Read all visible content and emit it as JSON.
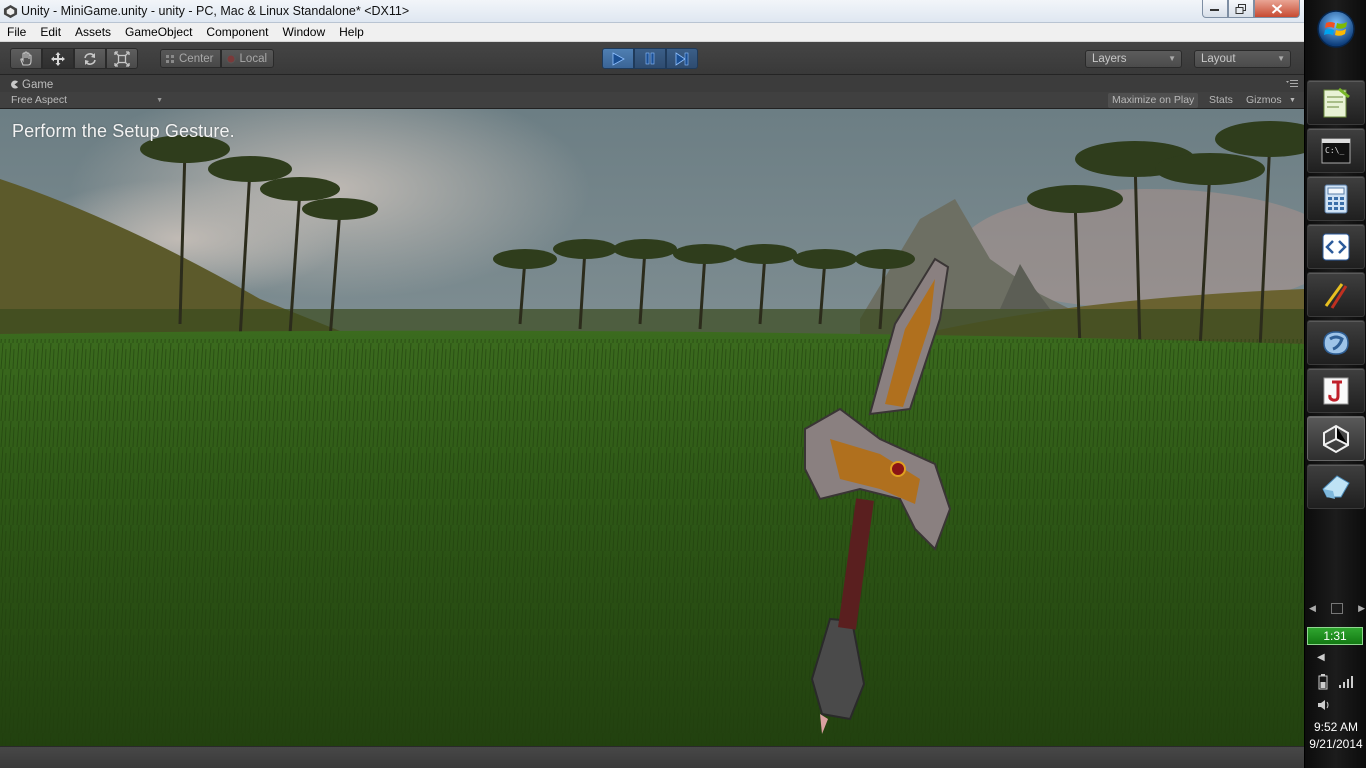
{
  "window": {
    "title": "Unity - MiniGame.unity - unity - PC, Mac & Linux Standalone* <DX11>"
  },
  "menu": {
    "items": [
      "File",
      "Edit",
      "Assets",
      "GameObject",
      "Component",
      "Window",
      "Help"
    ]
  },
  "toolbar": {
    "transform_tools": [
      "hand-icon",
      "move-icon",
      "rotate-icon",
      "scale-icon"
    ],
    "active_tool": "move-icon",
    "pivot_label": "Center",
    "space_label": "Local",
    "playback": [
      "play-icon",
      "pause-icon",
      "step-icon"
    ],
    "layers_label": "Layers",
    "layout_label": "Layout"
  },
  "game_panel": {
    "tab_label": "Game",
    "aspect_label": "Free Aspect",
    "maximize_label": "Maximize on Play",
    "stats_label": "Stats",
    "gizmos_label": "Gizmos"
  },
  "game_view": {
    "instruction_text": "Perform the Setup Gesture."
  },
  "taskbar": {
    "apps": [
      "notepad-plus-icon",
      "command-prompt-icon",
      "calculator-icon",
      "code-editor-icon",
      "paint-brush-icon",
      "kinect-studio-icon",
      "java-icon",
      "unity-icon",
      "eraser-icon"
    ],
    "active_app": "unity-icon",
    "battery_time": "1:31",
    "clock_time": "9:52 AM",
    "clock_date": "9/21/2014"
  },
  "colors": {
    "unity_toolbar": "#3e3e3e",
    "play_active": "#3f6b9e",
    "grass": "#2f5518",
    "sky": "#7e8f96",
    "battery_green": "#1f8f1f"
  }
}
